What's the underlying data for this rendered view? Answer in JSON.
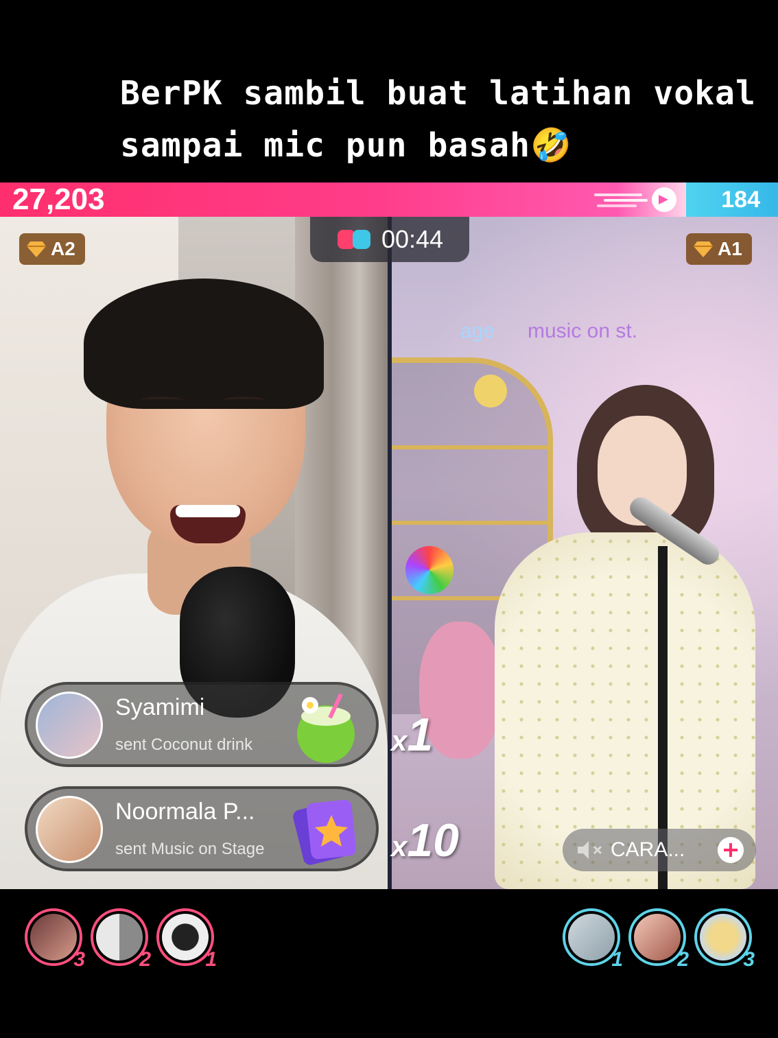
{
  "caption": {
    "line1": "BerPK sambil buat latihan vokal",
    "line2": "sampai mic pun basah🤣"
  },
  "battle": {
    "left_score": "27,203",
    "right_score": "184",
    "timer": "00:44",
    "left_rank": "A2",
    "right_rank": "A1",
    "colors": {
      "left": "#ff2f6d",
      "right": "#4fd3f0"
    }
  },
  "stream_overlay": {
    "text1": "age",
    "text2": "music on st."
  },
  "gifts": [
    {
      "name": "Syamimi",
      "description": "sent Coconut drink",
      "icon": "coconut-drink-icon",
      "combo_x": "x",
      "combo_n": "1"
    },
    {
      "name": "Noormala P...",
      "description": "sent Music on Stage",
      "icon": "music-on-stage-ticket-icon",
      "combo_x": "x",
      "combo_n": "10"
    }
  ],
  "song": {
    "label": "CARA...",
    "muted_icon": "speaker-muted-icon",
    "add_icon": "plus-icon"
  },
  "supporters_left": [
    {
      "rank": "3"
    },
    {
      "rank": "2"
    },
    {
      "rank": "1"
    }
  ],
  "supporters_right": [
    {
      "rank": "1"
    },
    {
      "rank": "2"
    },
    {
      "rank": "3"
    }
  ]
}
